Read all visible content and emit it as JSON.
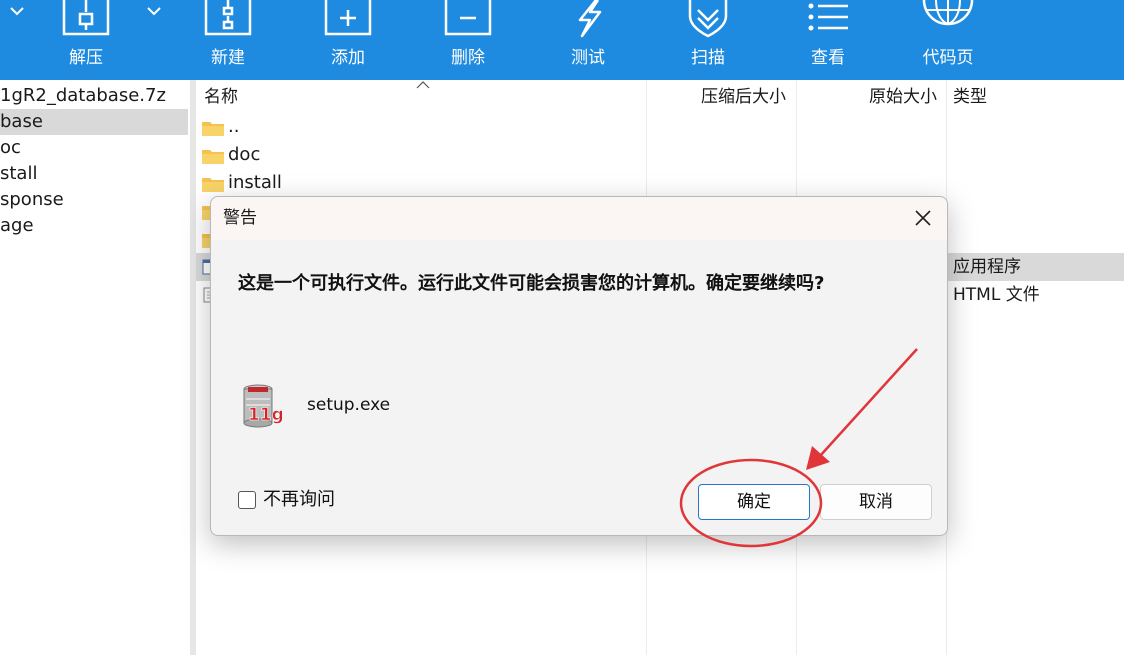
{
  "toolbar": {
    "items": [
      {
        "label": "解压",
        "icon": "extract-icon"
      },
      {
        "label": "新建",
        "icon": "new-archive-icon"
      },
      {
        "label": "添加",
        "icon": "add-icon"
      },
      {
        "label": "删除",
        "icon": "delete-icon"
      },
      {
        "label": "测试",
        "icon": "test-icon"
      },
      {
        "label": "扫描",
        "icon": "scan-icon"
      },
      {
        "label": "查看",
        "icon": "view-icon"
      },
      {
        "label": "代码页",
        "icon": "codepage-icon"
      }
    ]
  },
  "tree": {
    "items": [
      {
        "label": "1gR2_database.7z",
        "selected": false
      },
      {
        "label": "base",
        "selected": true
      },
      {
        "label": "oc",
        "selected": false
      },
      {
        "label": "stall",
        "selected": false
      },
      {
        "label": "sponse",
        "selected": false
      },
      {
        "label": "age",
        "selected": false
      }
    ]
  },
  "list": {
    "columns": {
      "name": "名称",
      "compressed": "压缩后大小",
      "original": "原始大小",
      "type": "类型"
    },
    "rows": [
      {
        "name": "..",
        "type": ""
      },
      {
        "name": "doc",
        "type": ""
      },
      {
        "name": "install",
        "type": ""
      },
      {
        "name": "",
        "type": "应用程序"
      },
      {
        "name": "",
        "type": "HTML 文件"
      }
    ]
  },
  "dialog": {
    "title": "警告",
    "message": "这是一个可执行文件。运行此文件可能会损害您的计算机。确定要继续吗?",
    "filename": "setup.exe",
    "file_icon_text": "11g",
    "checkbox_label": "不再询问",
    "checkbox_checked": false,
    "ok_label": "确定",
    "cancel_label": "取消"
  },
  "colors": {
    "toolbar": "#1e8be0",
    "annotation": "#e0363a",
    "ok_border": "#2a76c6"
  }
}
